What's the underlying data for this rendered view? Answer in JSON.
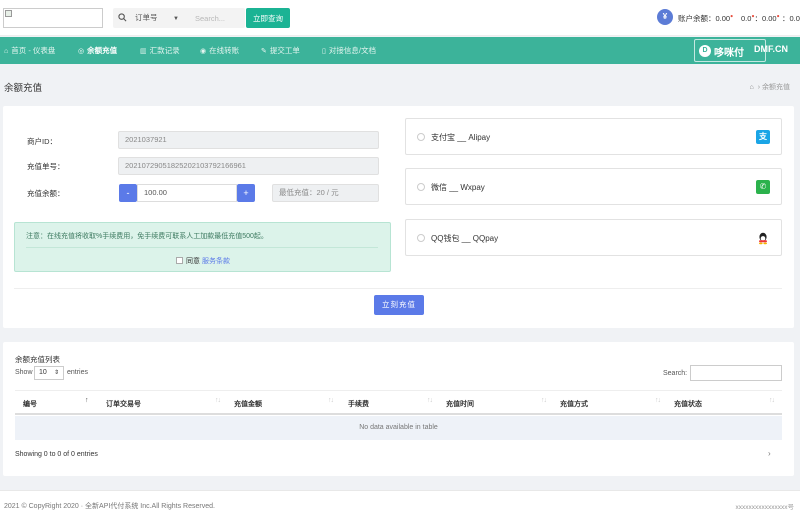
{
  "header": {
    "search_type": "订单号",
    "search_placeholder": "Search...",
    "search_button": "立即查询",
    "avatar_letter": "¥",
    "balance_1_label": "账户余额：",
    "balance_1_value": "0.00",
    "balance_2_label": "0.0",
    "balance_2_value": "：0.00",
    "balance_3_value": "：0.00"
  },
  "nav": {
    "items": [
      {
        "label": "首页 - 仪表盘",
        "icon": "⌂"
      },
      {
        "label": "余额充值",
        "icon": "◎"
      },
      {
        "label": "汇款记录",
        "icon": "▥"
      },
      {
        "label": "在线转账",
        "icon": "◉"
      },
      {
        "label": "提交工单",
        "icon": "✎"
      },
      {
        "label": "对接信息/文档",
        "icon": "▯"
      }
    ],
    "brand_text": "哆咪付",
    "brand_badge": "D",
    "brand_domain": "DMF.CN"
  },
  "page": {
    "title": "余额充值",
    "breadcrumb_current": "余额充值",
    "breadcrumb_sep": "›"
  },
  "form": {
    "merchant_label": "商户ID：",
    "merchant_value": "2021037921",
    "order_label": "充值单号：",
    "order_value": "20210729051825202103792166961",
    "amount_label": "充值余额：",
    "amount_value": "100.00",
    "minus": "-",
    "plus": "+",
    "min_text": "最低充值：20 / 元",
    "notice": "注意：在线充值将收取%手续费用，免手续费可联系人工加款最低充值500起。",
    "agree_text": "同意",
    "agree_link": "服务条款",
    "submit": "立刻充值"
  },
  "payments": [
    {
      "label": "支付宝 __ Alipay",
      "icon": "alipay-icon",
      "glyph": "支",
      "color": "#1aa5e6"
    },
    {
      "label": "微信 __ Wxpay",
      "icon": "wechat-icon",
      "glyph": "✆",
      "color": "#2bb24c"
    },
    {
      "label": "QQ钱包 __ QQpay",
      "icon": "qq-icon",
      "glyph": "●",
      "color": "#e8b21a"
    }
  ],
  "table": {
    "title": "余额充值列表",
    "show_label": "Show",
    "show_value": "10",
    "entries_label": "entries",
    "search_label": "Search:",
    "columns": [
      "编号",
      "订单交易号",
      "充值金额",
      "手续费",
      "充值时间",
      "充值方式",
      "充值状态"
    ],
    "empty_text": "No data available in table",
    "showing_text": "Showing 0 to 0 of 0 entries",
    "pager_next": "›"
  },
  "footer": {
    "left": "2021 © CopyRight 2020 · 全新API代付系统 Inc.All Rights Reserved.",
    "right": "xxxxxxxxxxxxxxxx号"
  }
}
